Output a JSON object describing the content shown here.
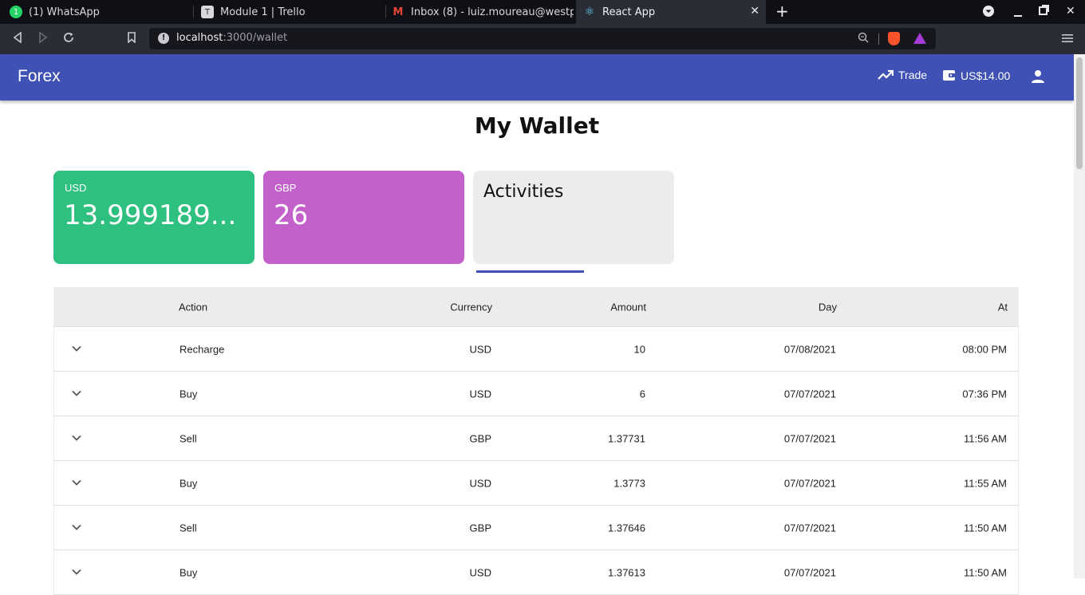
{
  "browser": {
    "tabs": [
      {
        "title": "(1) WhatsApp",
        "favicon": "whatsapp-icon"
      },
      {
        "title": "Module 1 | Trello",
        "favicon": "trello-icon"
      },
      {
        "title": "Inbox (8) - luiz.moureau@westpoi",
        "favicon": "gmail-icon"
      },
      {
        "title": "React App",
        "favicon": "react-icon"
      }
    ],
    "url_host": "localhost",
    "url_rest": ":3000/wallet"
  },
  "app": {
    "brand": "Forex",
    "trade_label": "Trade",
    "balance": "US$14.00",
    "page_title": "My Wallet"
  },
  "cards": {
    "usd": {
      "currency": "USD",
      "amount": "13.999189..."
    },
    "gbp": {
      "currency": "GBP",
      "amount": "26"
    },
    "activities": "Activities"
  },
  "table": {
    "headers": {
      "action": "Action",
      "currency": "Currency",
      "amount": "Amount",
      "day": "Day",
      "at": "At"
    },
    "rows": [
      {
        "action": "Recharge",
        "currency": "USD",
        "amount": "10",
        "day": "07/08/2021",
        "at": "08:00 PM"
      },
      {
        "action": "Buy",
        "currency": "USD",
        "amount": "6",
        "day": "07/07/2021",
        "at": "07:36 PM"
      },
      {
        "action": "Sell",
        "currency": "GBP",
        "amount": "1.37731",
        "day": "07/07/2021",
        "at": "11:56 AM"
      },
      {
        "action": "Buy",
        "currency": "USD",
        "amount": "1.3773",
        "day": "07/07/2021",
        "at": "11:55 AM"
      },
      {
        "action": "Sell",
        "currency": "GBP",
        "amount": "1.37646",
        "day": "07/07/2021",
        "at": "11:50 AM"
      },
      {
        "action": "Buy",
        "currency": "USD",
        "amount": "1.37613",
        "day": "07/07/2021",
        "at": "11:50 AM"
      }
    ]
  },
  "colors": {
    "primary": "#3f51b5",
    "usd_card": "#2ec07f",
    "gbp_card": "#c360cb"
  }
}
